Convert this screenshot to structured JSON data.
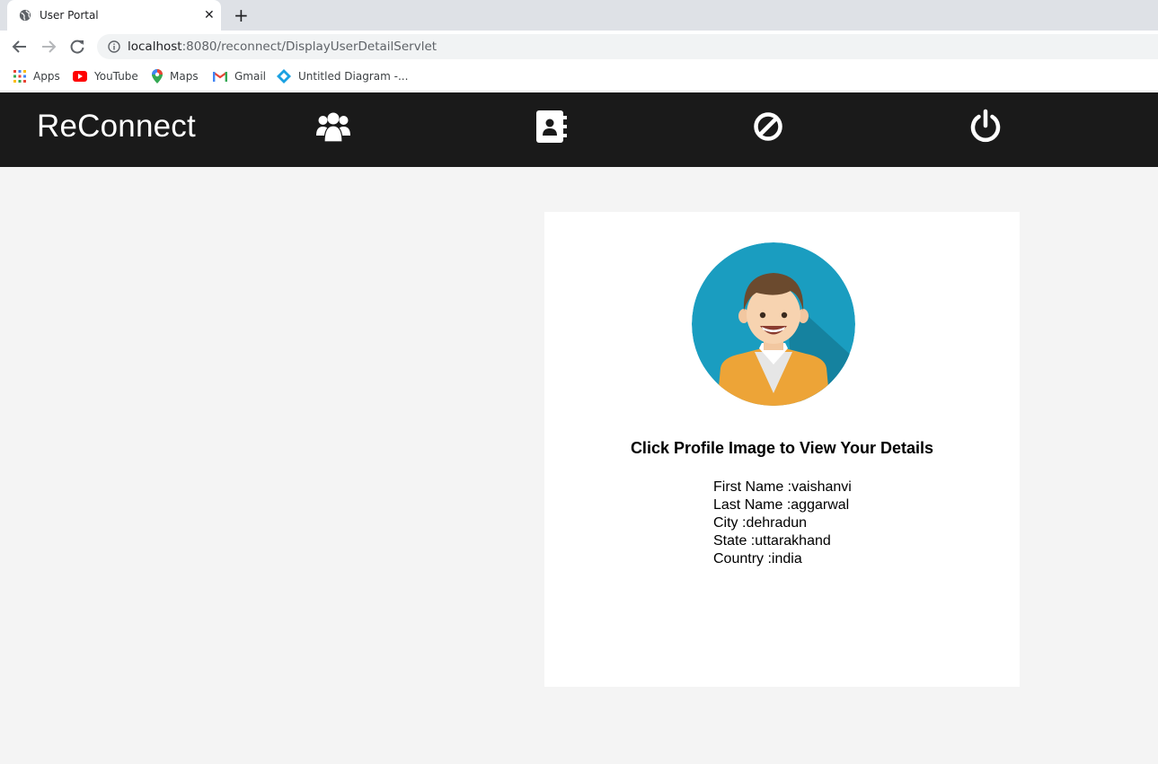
{
  "browser": {
    "tab_title": "User Portal",
    "tab_close": "✕",
    "new_tab": "+",
    "url_host": "localhost",
    "url_rest": ":8080/reconnect/DisplayUserDetailServlet",
    "bookmarks": [
      "Apps",
      "YouTube",
      "Maps",
      "Gmail",
      "Untitled Diagram -..."
    ]
  },
  "app": {
    "brand": "ReConnect",
    "nav_icons": [
      "users-icon",
      "address-book-icon",
      "ban-icon",
      "power-icon"
    ]
  },
  "profile": {
    "heading": "Click Profile Image to View Your Details",
    "fields": [
      {
        "label": "First Name",
        "value": "vaishanvi"
      },
      {
        "label": "Last Name",
        "value": "aggarwal"
      },
      {
        "label": "City",
        "value": "dehradun"
      },
      {
        "label": "State",
        "value": "uttarakhand"
      },
      {
        "label": "Country",
        "value": "india"
      }
    ]
  }
}
